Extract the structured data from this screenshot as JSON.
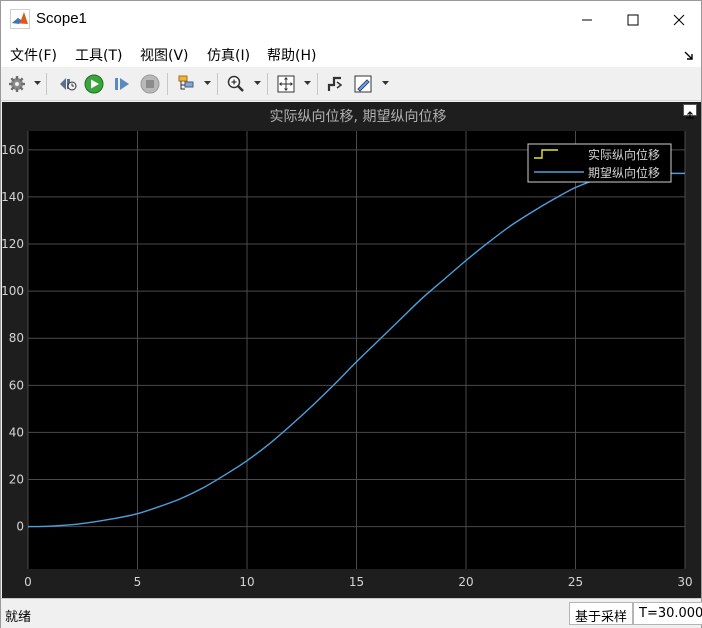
{
  "window": {
    "title": "Scope1",
    "icon": "matlab-logo-icon",
    "buttons": [
      "minimize-icon",
      "maximize-icon",
      "close-icon"
    ]
  },
  "menu": {
    "items": [
      {
        "label": "文件(F)"
      },
      {
        "label": "工具(T)"
      },
      {
        "label": "视图(V)"
      },
      {
        "label": "仿真(I)"
      },
      {
        "label": "帮助(H)"
      }
    ]
  },
  "toolbar": {
    "icons": [
      "gear-icon",
      "step-back-icon",
      "run-icon",
      "step-forward-icon",
      "stop-icon",
      "signal-selector-icon",
      "zoom-in-icon",
      "autoscale-icon",
      "triggers-icon",
      "highlight-icon"
    ]
  },
  "status": {
    "left": "就绪",
    "mode": "基于采样",
    "time": "T=30.000"
  },
  "chart_data": {
    "type": "line",
    "title": "实际纵向位移, 期望纵向位移",
    "xlabel": "",
    "ylabel": "",
    "xlim": [
      0,
      30
    ],
    "ylim": [
      -18,
      168
    ],
    "xticks": [
      0,
      5,
      10,
      15,
      20,
      25,
      30
    ],
    "yticks": [
      0,
      20,
      40,
      60,
      80,
      100,
      120,
      140,
      160
    ],
    "grid": true,
    "legend_position": "top-right",
    "colors": {
      "background": "#000000",
      "panel": "#1e1e1e",
      "grid": "#4a4a4a",
      "axis_text": "#d4d4d4",
      "title": "#b0b0b0"
    },
    "series": [
      {
        "name": "实际纵向位移",
        "color": "#e5e52a",
        "style": "step",
        "x": [],
        "y": []
      },
      {
        "name": "期望纵向位移",
        "color": "#4d9fdd",
        "style": "line",
        "x": [
          0,
          1,
          2,
          3,
          4,
          5,
          6,
          7,
          8,
          9,
          10,
          11,
          12,
          13,
          14,
          15,
          16,
          17,
          18,
          19,
          20,
          21,
          22,
          23,
          24,
          25,
          26,
          27,
          28,
          29,
          30
        ],
        "y": [
          0,
          0.2,
          0.8,
          2.0,
          3.5,
          5.5,
          8.5,
          12.0,
          16.5,
          22.0,
          28.0,
          35.0,
          43.0,
          51.5,
          60.5,
          70.0,
          79.0,
          88.0,
          97.0,
          105.0,
          113.0,
          120.5,
          127.5,
          133.5,
          139.0,
          144.0,
          147.5,
          149.5,
          150.0,
          150.0,
          150.0
        ]
      }
    ]
  }
}
